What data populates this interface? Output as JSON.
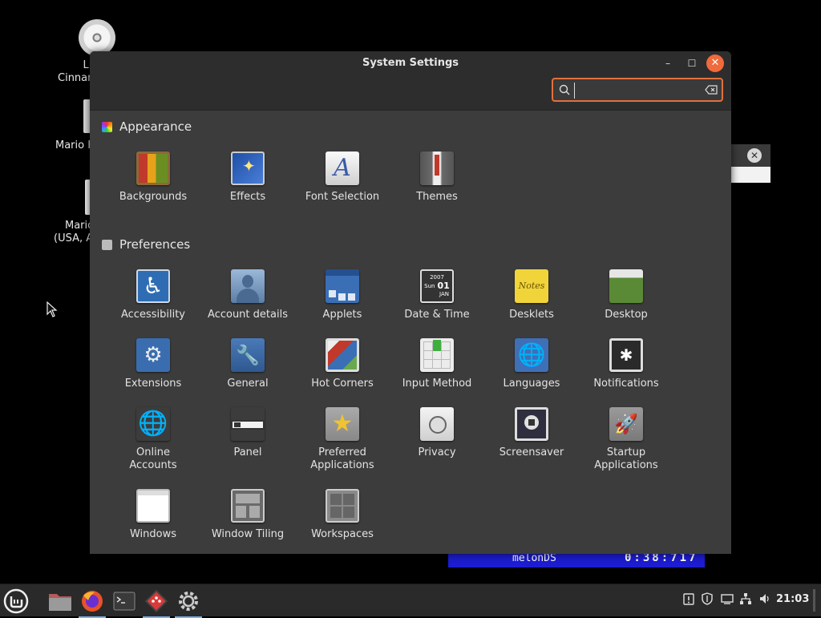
{
  "desktop": {
    "icons": [
      {
        "label": "Linux\nCinnar",
        "line1": "Linux",
        "line2": "Cinnar"
      },
      {
        "line1": "Mario K"
      },
      {
        "line1": "Mario",
        "line2": "(USA, A"
      }
    ],
    "game_overlay": {
      "text": "melonDS",
      "counter": "0:38:717"
    }
  },
  "window": {
    "title": "System Settings",
    "search": {
      "value": "",
      "placeholder": ""
    },
    "controls": {
      "minimize": "–",
      "maximize": "☐",
      "close": "✕"
    }
  },
  "sections": {
    "appearance": {
      "title": "Appearance",
      "items": [
        "Backgrounds",
        "Effects",
        "Font Selection",
        "Themes"
      ]
    },
    "preferences": {
      "title": "Preferences",
      "items": [
        "Accessibility",
        "Account details",
        "Applets",
        "Date & Time",
        "Desklets",
        "Desktop",
        "Extensions",
        "General",
        "Hot Corners",
        "Input Method",
        "Languages",
        "Notifications",
        "Online\nAccounts",
        "Panel",
        "Preferred\nApplications",
        "Privacy",
        "Screensaver",
        "Startup\nApplications",
        "Windows",
        "Window Tiling",
        "Workspaces"
      ],
      "multi": {
        "online_1": "Online",
        "online_2": "Accounts",
        "pref_1": "Preferred",
        "pref_2": "Applications",
        "start_1": "Startup",
        "start_2": "Applications"
      }
    }
  },
  "date_icon": {
    "year": "2007",
    "day": "Sun",
    "num": "01",
    "month": "JAN"
  },
  "desklets_icon": "Notes",
  "font_icon": "A",
  "taskbar": {
    "clock": "21:03",
    "apps": [
      "menu",
      "files",
      "firefox",
      "terminal",
      "game",
      "settings"
    ]
  },
  "colors": {
    "accent": "#e2703c",
    "close": "#f06a3c",
    "window_bg": "#3c3c3c",
    "titlebar": "#2d2d2d"
  }
}
